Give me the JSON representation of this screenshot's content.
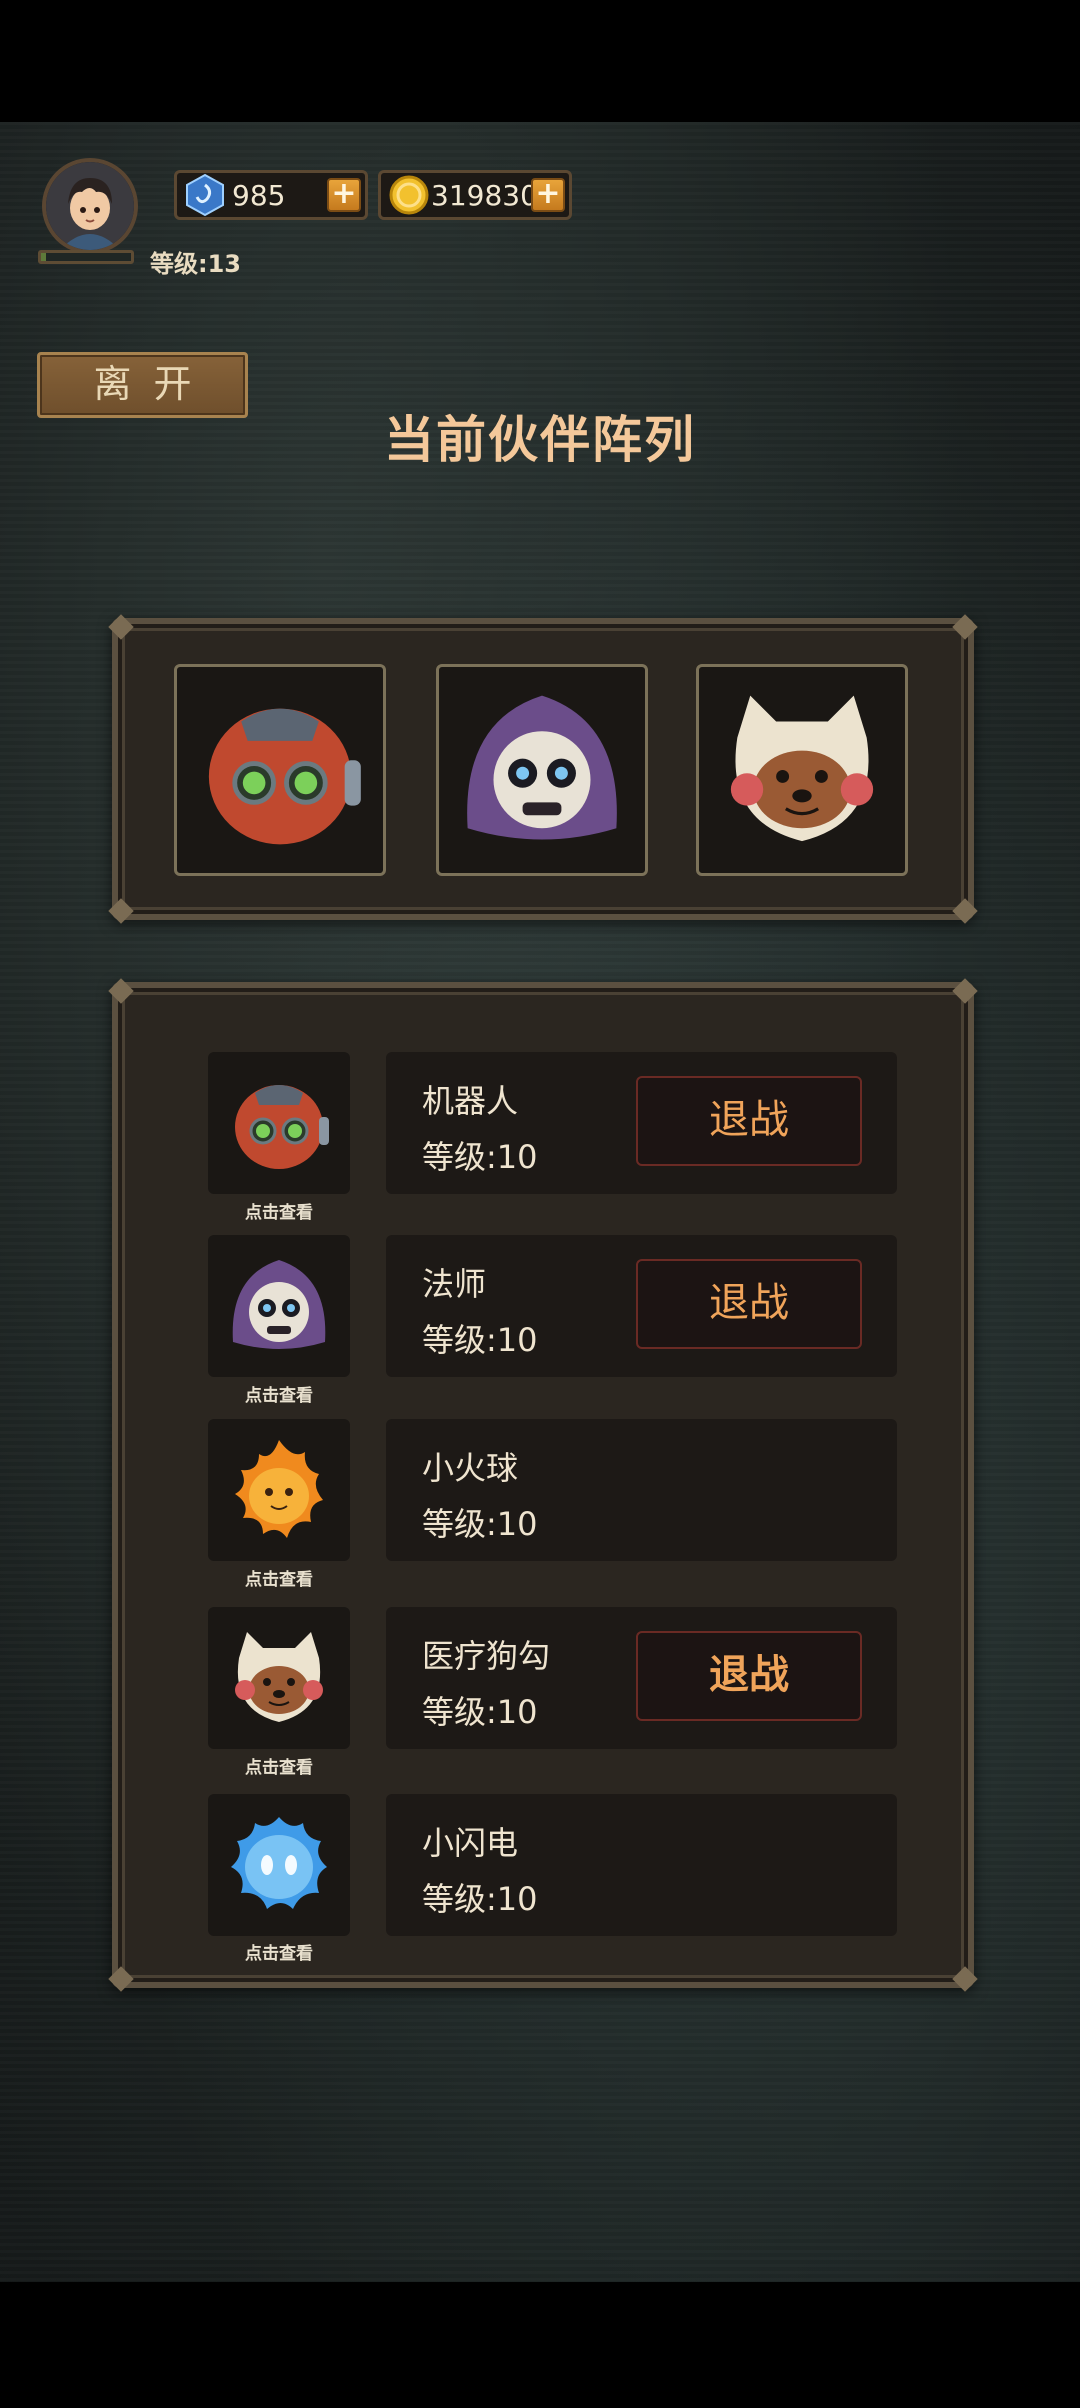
{
  "player": {
    "level_label": "等级:13",
    "xp_fraction": 0.05
  },
  "resources": {
    "gems": "985",
    "gold": "319830",
    "plus": "+"
  },
  "leave_button": "离开",
  "title": "当前伙伴阵列",
  "lineup": [
    {
      "icon": "robot-icon"
    },
    {
      "icon": "skull-mage-icon"
    },
    {
      "icon": "dog-icon"
    }
  ],
  "roster": [
    {
      "name": "机器人",
      "level": "等级:10",
      "view": "点击查看",
      "action": "退战",
      "icon": "robot-icon"
    },
    {
      "name": "法师",
      "level": "等级:10",
      "view": "点击查看",
      "action": "退战",
      "icon": "skull-mage-icon"
    },
    {
      "name": "小火球",
      "level": "等级:10",
      "view": "点击查看",
      "action": "",
      "icon": "fireball-icon"
    },
    {
      "name": "医疗狗勾",
      "level": "等级:10",
      "view": "点击查看",
      "action": "退战",
      "icon": "dog-icon"
    },
    {
      "name": "小闪电",
      "level": "等级:10",
      "view": "点击查看",
      "action": "",
      "icon": "lightning-icon"
    }
  ],
  "colors": {
    "title": "#f4c89a",
    "retire_text": "#f0a45a",
    "panel": "#2b2620"
  }
}
